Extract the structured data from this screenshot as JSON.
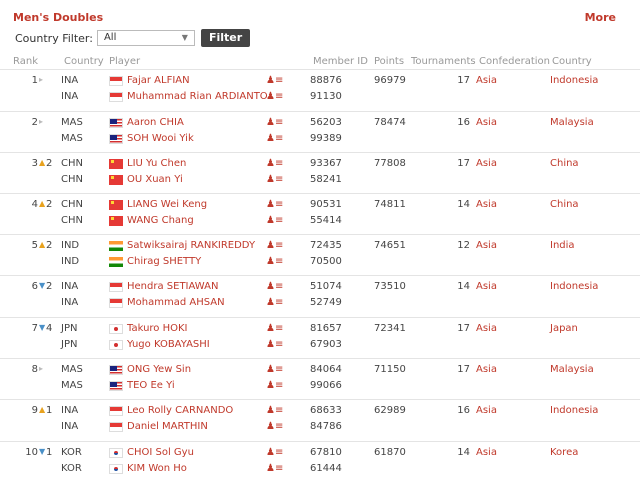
{
  "header": {
    "title": "Men's Doubles",
    "more": "More"
  },
  "filter": {
    "label": "Country Filter:",
    "selected": "All",
    "button": "Filter"
  },
  "columns": {
    "rank": "Rank",
    "country": "Country",
    "player": "Player",
    "member_id": "Member ID",
    "points": "Points",
    "tournaments": "Tournaments",
    "confederation": "Confederation",
    "country_name": "Country"
  },
  "rows": [
    {
      "rank": "1",
      "trend": "flat",
      "change": "",
      "points": "96979",
      "tournaments": "17",
      "confederation": "Asia",
      "country": "Indonesia",
      "players": [
        {
          "code": "INA",
          "flag": "ina",
          "name": "Fajar ALFIAN",
          "id": "88876"
        },
        {
          "code": "INA",
          "flag": "ina",
          "name": "Muhammad Rian ARDIANTO",
          "id": "91130"
        }
      ]
    },
    {
      "rank": "2",
      "trend": "flat",
      "change": "",
      "points": "78474",
      "tournaments": "16",
      "confederation": "Asia",
      "country": "Malaysia",
      "players": [
        {
          "code": "MAS",
          "flag": "mas",
          "name": "Aaron CHIA",
          "id": "56203"
        },
        {
          "code": "MAS",
          "flag": "mas",
          "name": "SOH Wooi Yik",
          "id": "99389"
        }
      ]
    },
    {
      "rank": "3",
      "trend": "up",
      "change": "2",
      "points": "77808",
      "tournaments": "17",
      "confederation": "Asia",
      "country": "China",
      "players": [
        {
          "code": "CHN",
          "flag": "chn",
          "name": "LIU Yu Chen",
          "id": "93367"
        },
        {
          "code": "CHN",
          "flag": "chn",
          "name": "OU Xuan Yi",
          "id": "58241"
        }
      ]
    },
    {
      "rank": "4",
      "trend": "up",
      "change": "2",
      "points": "74811",
      "tournaments": "14",
      "confederation": "Asia",
      "country": "China",
      "players": [
        {
          "code": "CHN",
          "flag": "chn",
          "name": "LIANG Wei Keng",
          "id": "90531"
        },
        {
          "code": "CHN",
          "flag": "chn",
          "name": "WANG Chang",
          "id": "55414"
        }
      ]
    },
    {
      "rank": "5",
      "trend": "up",
      "change": "2",
      "points": "74651",
      "tournaments": "12",
      "confederation": "Asia",
      "country": "India",
      "players": [
        {
          "code": "IND",
          "flag": "ind",
          "name": "Satwiksairaj RANKIREDDY",
          "id": "72435"
        },
        {
          "code": "IND",
          "flag": "ind",
          "name": "Chirag SHETTY",
          "id": "70500"
        }
      ]
    },
    {
      "rank": "6",
      "trend": "down",
      "change": "2",
      "points": "73510",
      "tournaments": "14",
      "confederation": "Asia",
      "country": "Indonesia",
      "players": [
        {
          "code": "INA",
          "flag": "ina",
          "name": "Hendra SETIAWAN",
          "id": "51074"
        },
        {
          "code": "INA",
          "flag": "ina",
          "name": "Mohammad AHSAN",
          "id": "52749"
        }
      ]
    },
    {
      "rank": "7",
      "trend": "down",
      "change": "4",
      "points": "72341",
      "tournaments": "17",
      "confederation": "Asia",
      "country": "Japan",
      "players": [
        {
          "code": "JPN",
          "flag": "jpn",
          "name": "Takuro HOKI",
          "id": "81657"
        },
        {
          "code": "JPN",
          "flag": "jpn",
          "name": "Yugo KOBAYASHI",
          "id": "67903"
        }
      ]
    },
    {
      "rank": "8",
      "trend": "flat",
      "change": "",
      "points": "71150",
      "tournaments": "17",
      "confederation": "Asia",
      "country": "Malaysia",
      "players": [
        {
          "code": "MAS",
          "flag": "mas",
          "name": "ONG Yew Sin",
          "id": "84064"
        },
        {
          "code": "MAS",
          "flag": "mas",
          "name": "TEO Ee Yi",
          "id": "99066"
        }
      ]
    },
    {
      "rank": "9",
      "trend": "up",
      "change": "1",
      "points": "62989",
      "tournaments": "16",
      "confederation": "Asia",
      "country": "Indonesia",
      "players": [
        {
          "code": "INA",
          "flag": "ina",
          "name": "Leo Rolly CARNANDO",
          "id": "68633"
        },
        {
          "code": "INA",
          "flag": "ina",
          "name": "Daniel MARTHIN",
          "id": "84786"
        }
      ]
    },
    {
      "rank": "10",
      "trend": "down",
      "change": "1",
      "points": "61870",
      "tournaments": "14",
      "confederation": "Asia",
      "country": "Korea",
      "players": [
        {
          "code": "KOR",
          "flag": "kor",
          "name": "CHOI Sol Gyu",
          "id": "67810"
        },
        {
          "code": "KOR",
          "flag": "kor",
          "name": "KIM Won Ho",
          "id": "61444"
        }
      ]
    }
  ]
}
